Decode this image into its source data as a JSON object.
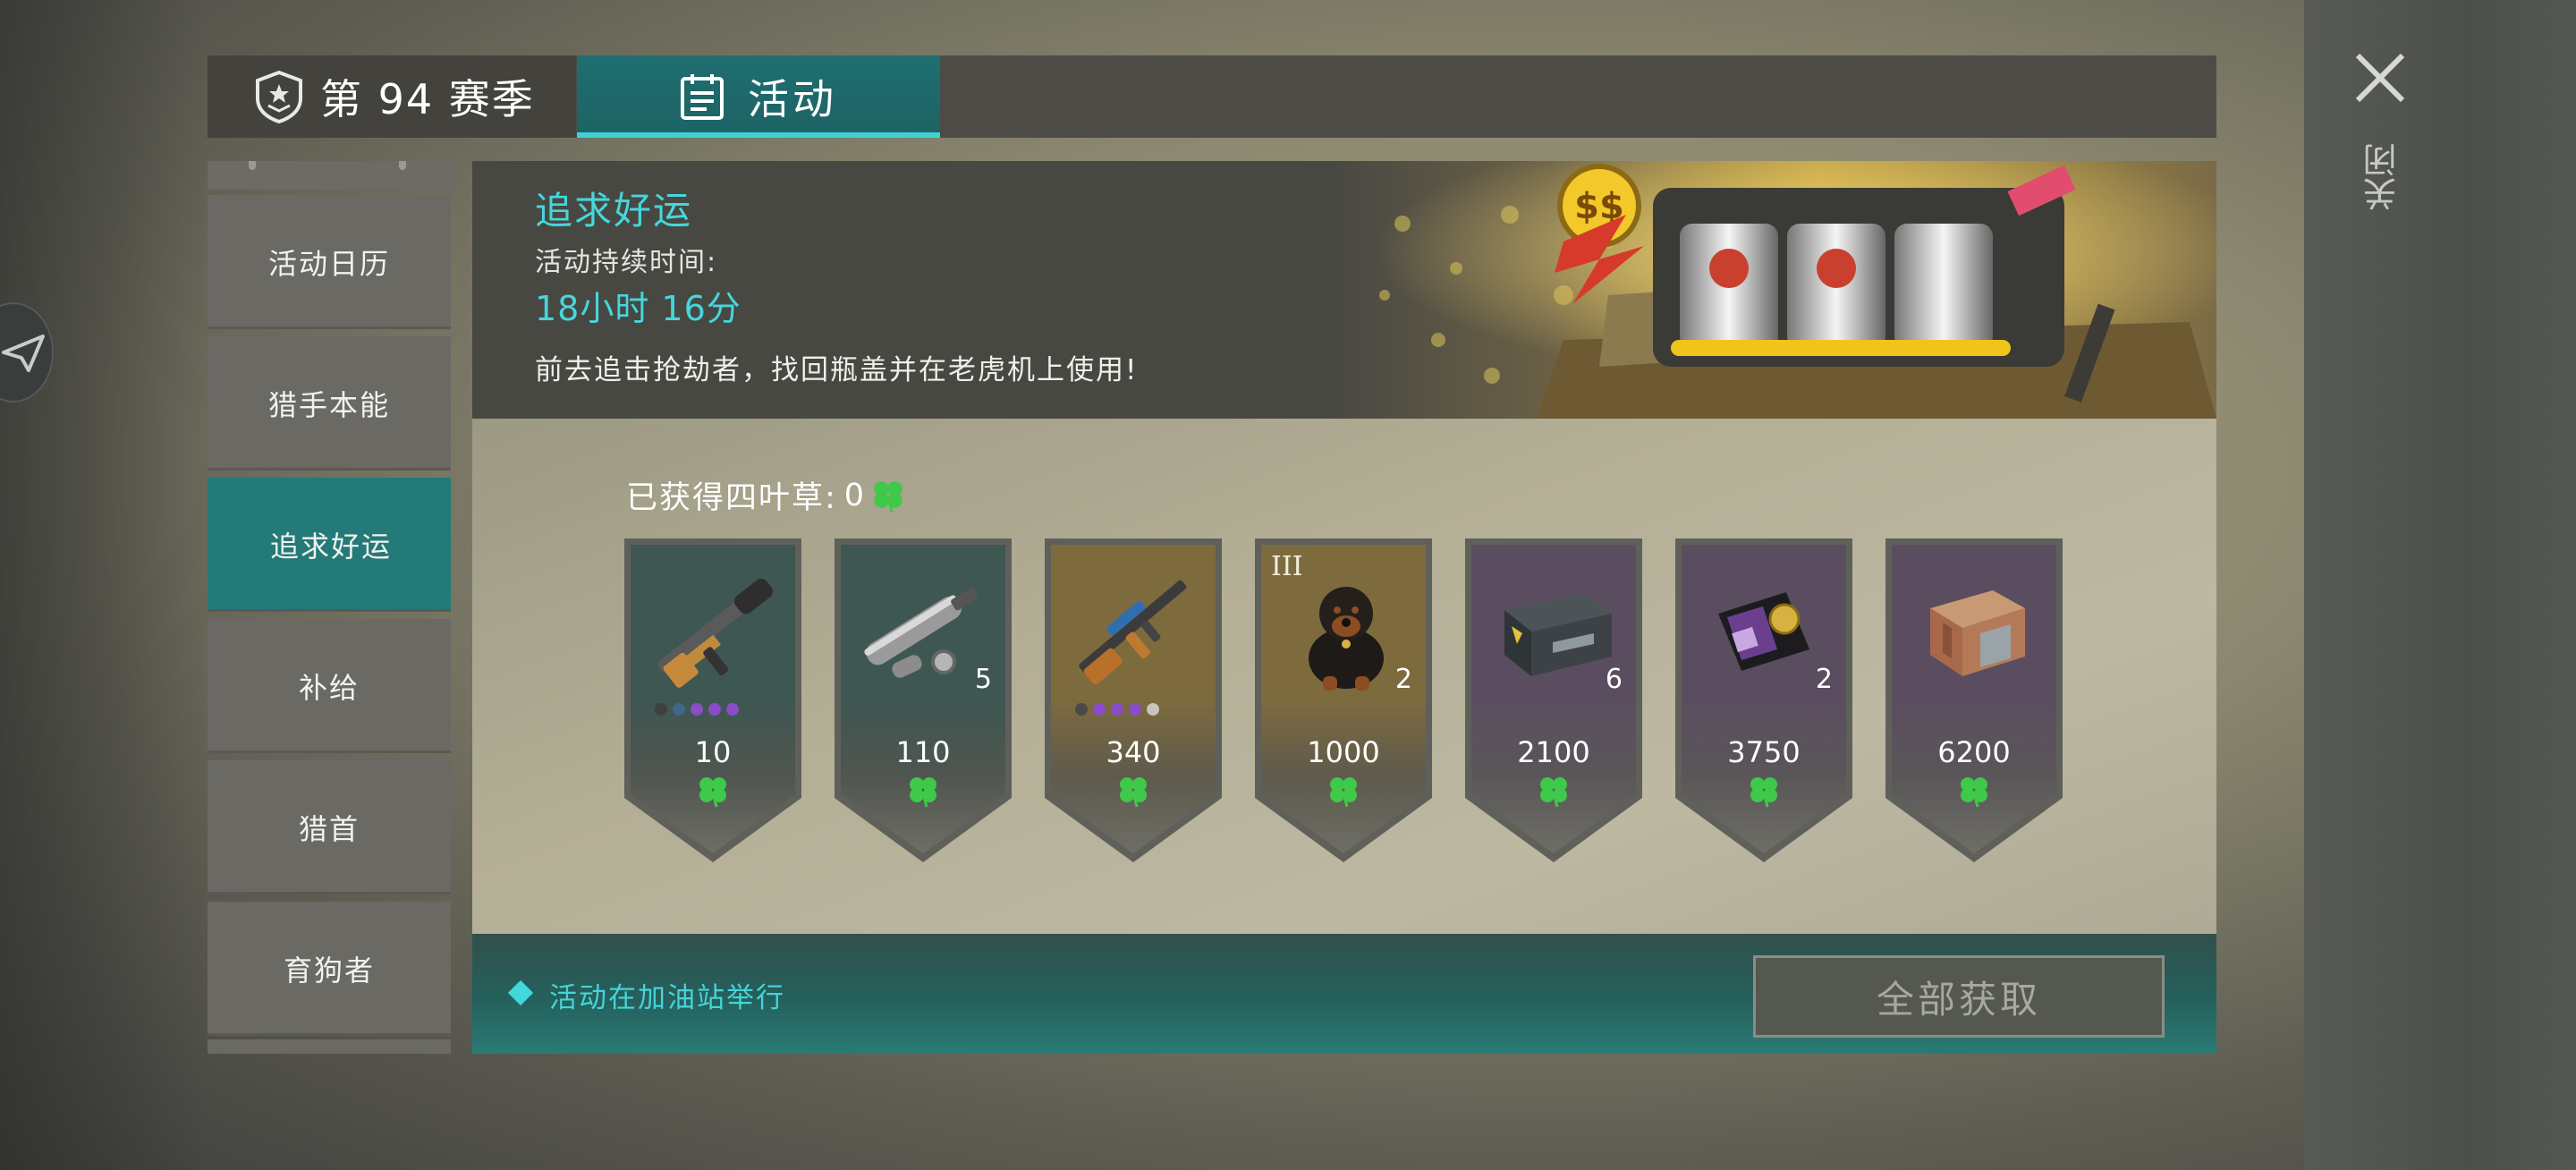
{
  "tabs": {
    "season": "第 94 赛季",
    "activity": "活动"
  },
  "close": {
    "label": "关闭"
  },
  "menu": {
    "items": [
      {
        "label": "活动日历",
        "active": false
      },
      {
        "label": "猎手本能",
        "active": false
      },
      {
        "label": "追求好运",
        "active": true
      },
      {
        "label": "补给",
        "active": false
      },
      {
        "label": "猎首",
        "active": false
      },
      {
        "label": "育狗者",
        "active": false
      }
    ]
  },
  "event": {
    "title": "追求好运",
    "duration_label": "活动持续时间:",
    "time_left": "18小时 16分",
    "description": "前去追击抢劫者，找回瓶盖并在老虎机上使用!"
  },
  "obtained": {
    "label": "已获得四叶草:",
    "count": "0"
  },
  "rewards": [
    {
      "icon": "smg-rifle-icon",
      "cost": "10",
      "quantity": "",
      "tier": "",
      "theme": "teal"
    },
    {
      "icon": "silencer-parts-icon",
      "cost": "110",
      "quantity": "5",
      "tier": "",
      "theme": "teal"
    },
    {
      "icon": "assault-rifle-icon",
      "cost": "340",
      "quantity": "",
      "tier": "",
      "theme": "gold"
    },
    {
      "icon": "rottweiler-dog-icon",
      "cost": "1000",
      "quantity": "2",
      "tier": "III",
      "theme": "gold"
    },
    {
      "icon": "weapon-crate-icon",
      "cost": "2100",
      "quantity": "6",
      "tier": "",
      "theme": "purple"
    },
    {
      "icon": "police-badge-icon",
      "cost": "3750",
      "quantity": "2",
      "tier": "",
      "theme": "purple"
    },
    {
      "icon": "wooden-crate-icon",
      "cost": "6200",
      "quantity": "",
      "tier": "",
      "theme": "purple"
    }
  ],
  "footer": {
    "location_text": "活动在加油站举行",
    "claim_all_label": "全部获取"
  },
  "colors": {
    "accent": "#46d6dc",
    "clover": "#3ec94a",
    "teal_card": "#3e5752",
    "gold_card": "#7d6b3e",
    "purple_card": "#5b4d60"
  }
}
